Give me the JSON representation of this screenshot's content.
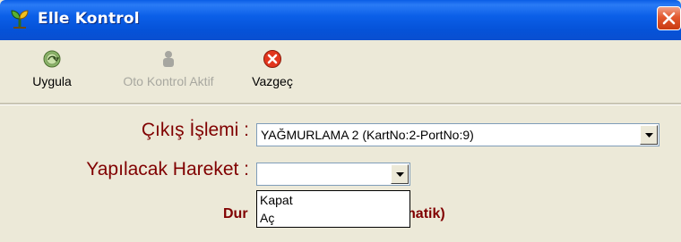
{
  "window": {
    "title": "Elle Kontrol",
    "icon": "plant-icon",
    "close_icon": "close-icon"
  },
  "toolbar": {
    "buttons": [
      {
        "label": "Uygula",
        "icon": "apply-icon",
        "enabled": true
      },
      {
        "label": "Oto Kontrol Aktif",
        "icon": "hand-icon",
        "enabled": false
      },
      {
        "label": "Vazgeç",
        "icon": "cancel-icon",
        "enabled": true
      }
    ]
  },
  "form": {
    "output_label": "Çıkış İşlemi :",
    "output_value": "YAĞMURLAMA 2 (KartNo:2-PortNo:9)",
    "action_label": "Yapılacak Hareket :",
    "action_value": "",
    "action_options": [
      "Kapat",
      "Aç"
    ]
  },
  "status": {
    "text_left": "Dur",
    "text_right": "matik)"
  },
  "colors": {
    "title_bar": "#0a5de6",
    "label_text": "#800000",
    "window_bg": "#ece9d8",
    "close_button": "#e2582e"
  }
}
